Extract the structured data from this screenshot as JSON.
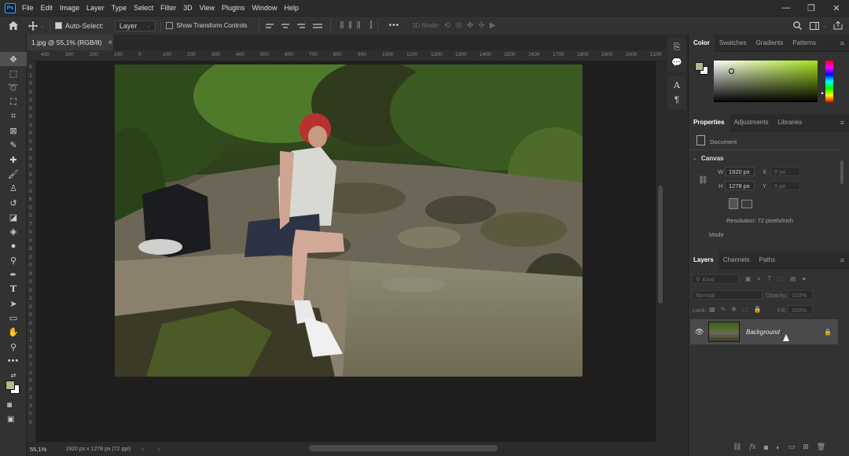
{
  "app": {
    "logo": "Ps"
  },
  "menu": [
    "File",
    "Edit",
    "Image",
    "Layer",
    "Type",
    "Select",
    "Filter",
    "3D",
    "View",
    "Plugins",
    "Window",
    "Help"
  ],
  "window_controls": {
    "minimize": "—",
    "maximize": "❐",
    "close": "✕"
  },
  "options_bar": {
    "auto_select_label": "Auto-Select:",
    "auto_select_checked": true,
    "auto_select_target": "Layer",
    "show_transform_label": "Show Transform Controls",
    "show_transform_checked": false,
    "more": "•••",
    "mode_3d_label": "3D Mode:"
  },
  "document": {
    "tab_title": "1.jpg @ 55,1% (RGB/8)",
    "tab_close": "×",
    "zoom": "55,1%",
    "doc_info": "1920 px x 1278 px (72 ppi)"
  },
  "rulers": {
    "h_ticks": [
      "400",
      "300",
      "200",
      "100",
      "0",
      "100",
      "200",
      "300",
      "400",
      "500",
      "600",
      "700",
      "800",
      "900",
      "1000",
      "1100",
      "1200",
      "1300",
      "1400",
      "1500",
      "1600",
      "1700",
      "1800",
      "1900",
      "2000",
      "2100",
      "22"
    ],
    "v_ticks": [
      "0",
      "1",
      "0",
      "0",
      "2",
      "0",
      "0",
      "3",
      "0",
      "0",
      "4",
      "0",
      "0",
      "5",
      "0",
      "0",
      "6",
      "0",
      "0",
      "7",
      "0",
      "0",
      "8",
      "0",
      "0",
      "9",
      "0",
      "0",
      "1",
      "0",
      "0",
      "0",
      "1",
      "1",
      "0",
      "0",
      "1",
      "2",
      "0",
      "0",
      "1",
      "3",
      "0",
      "0"
    ]
  },
  "color_panel": {
    "tabs": [
      "Color",
      "Swatches",
      "Gradients",
      "Patterns"
    ],
    "active_tab": "Color",
    "foreground": "#b5b58e",
    "background": "#ffffff",
    "hue_color": "#a6e31a"
  },
  "properties_panel": {
    "tabs": [
      "Properties",
      "Adjustments",
      "Libraries"
    ],
    "active_tab": "Properties",
    "doc_label": "Document",
    "section": "Canvas",
    "w_label": "W",
    "w_value": "1920 px",
    "h_label": "H",
    "h_value": "1278 px",
    "x_label": "X",
    "x_placeholder": "0 px",
    "y_label": "Y",
    "y_placeholder": "0 px",
    "resolution": "Resolution: 72 pixels/inch",
    "mode_label": "Mode"
  },
  "layers_panel": {
    "tabs": [
      "Layers",
      "Channels",
      "Paths"
    ],
    "active_tab": "Layers",
    "kind_label": "Kind",
    "blend_mode": "Normal",
    "opacity_label": "Opacity:",
    "opacity_value": "100%",
    "lock_label": "Lock:",
    "fill_label": "Fill:",
    "fill_value": "100%",
    "layer_name": "Background"
  },
  "colors": {
    "accent": "#31a8ff",
    "panel_bg": "#323232",
    "canvas_bg": "#1e1e1e"
  }
}
